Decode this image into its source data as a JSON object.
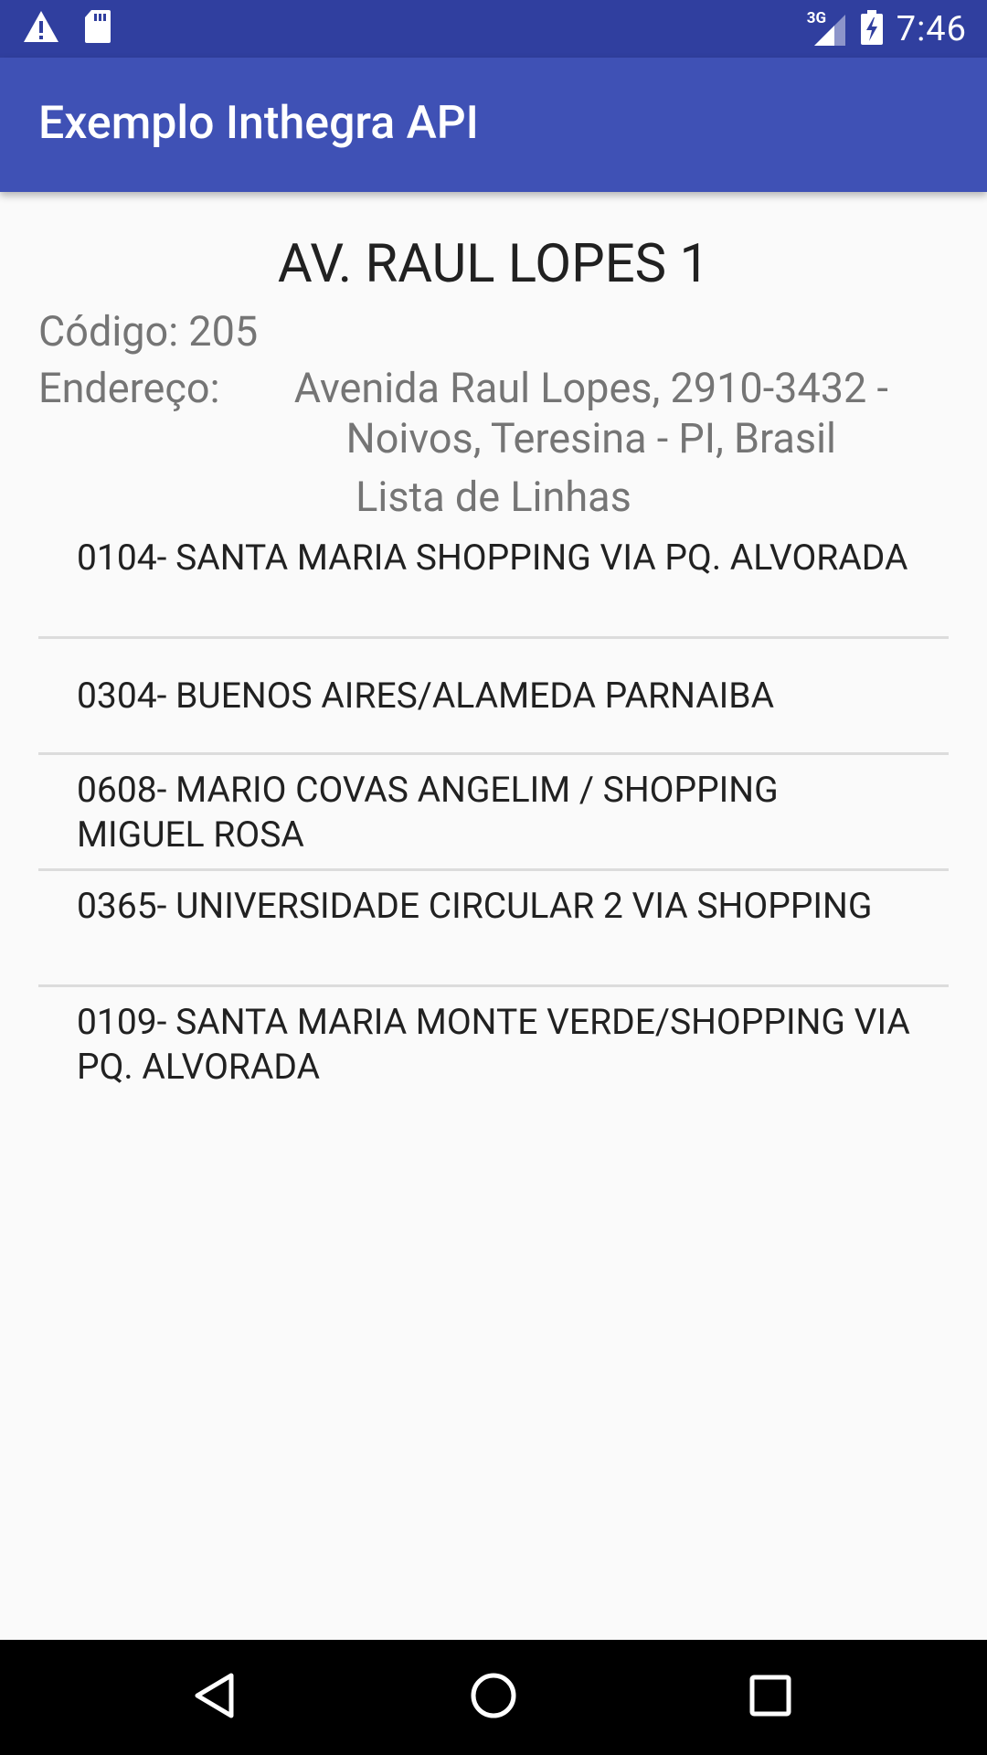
{
  "status_bar": {
    "time": "7:46",
    "network_label": "3G",
    "icons": [
      "warning-icon",
      "sd-card-icon",
      "signal-icon",
      "battery-charging-icon"
    ]
  },
  "app_bar": {
    "title": "Exemplo Inthegra API"
  },
  "stop": {
    "name": "AV. RAUL LOPES 1",
    "code_label": "Código: ",
    "code": "205",
    "address_label": "Endereço: ",
    "address": "Avenida Raul Lopes, 2910-3432 - Noivos, Teresina - PI, Brasil"
  },
  "lines_heading": "Lista de Linhas",
  "lines": [
    "0104- SANTA MARIA SHOPPING VIA PQ. ALVORADA",
    "0304- BUENOS AIRES/ALAMEDA PARNAIBA",
    "0608- MARIO COVAS ANGELIM / SHOPPING MIGUEL ROSA",
    "0365- UNIVERSIDADE CIRCULAR 2 VIA SHOPPING",
    "0109- SANTA MARIA MONTE VERDE/SHOPPING VIA PQ. ALVORADA"
  ],
  "nav_bar": {
    "icons": [
      "back-icon",
      "home-icon",
      "recents-icon"
    ]
  },
  "colors": {
    "status_bar": "#303f9f",
    "app_bar": "#3f51b5",
    "background": "#fafafa",
    "secondary_text": "#757575",
    "primary_text": "#212121",
    "divider": "#dcdcdc"
  }
}
